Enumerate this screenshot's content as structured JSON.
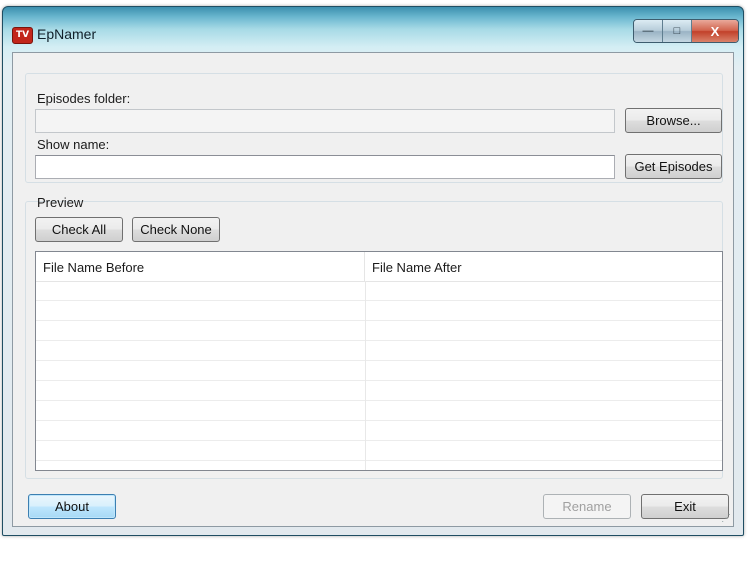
{
  "window": {
    "title": "EpNamer",
    "app_icon_text": "TV",
    "minimize_glyph": "—",
    "maximize_glyph": "□",
    "close_glyph": "X"
  },
  "folder": {
    "label": "Episodes folder:",
    "value": "",
    "browse_label": "Browse..."
  },
  "show": {
    "label": "Show name:",
    "value": "",
    "get_episodes_label": "Get Episodes"
  },
  "preview": {
    "label": "Preview",
    "check_all_label": "Check All",
    "check_none_label": "Check None",
    "columns": [
      "File Name Before",
      "File Name After"
    ]
  },
  "footer": {
    "about_label": "About",
    "rename_label": "Rename",
    "exit_label": "Exit"
  }
}
